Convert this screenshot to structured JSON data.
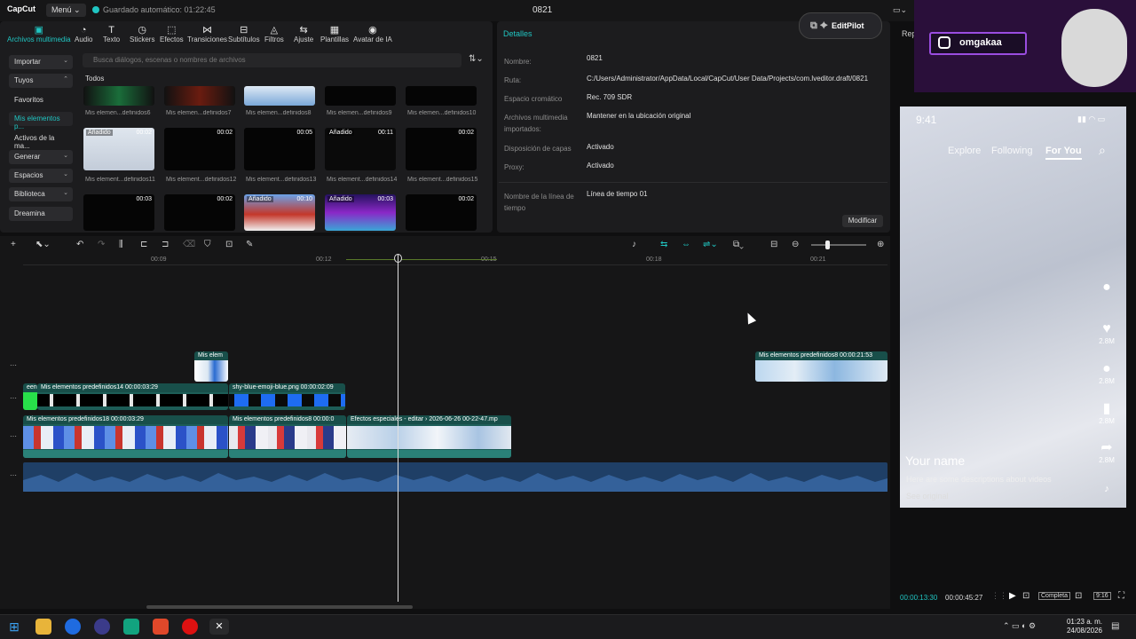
{
  "app": {
    "logo": "CapCut",
    "menu_label": "Menú",
    "autosave": "Guardado automático: 01:22:45",
    "project_name": "0821"
  },
  "toolbar": {
    "items": [
      {
        "label": "Archivos multimedia",
        "icon": "media-icon"
      },
      {
        "label": "Audio",
        "icon": "audio-icon"
      },
      {
        "label": "Texto",
        "icon": "text-icon"
      },
      {
        "label": "Stickers",
        "icon": "stickers-icon"
      },
      {
        "label": "Efectos",
        "icon": "effects-icon"
      },
      {
        "label": "Transiciones",
        "icon": "transitions-icon"
      },
      {
        "label": "Subtítulos",
        "icon": "subtitles-icon"
      },
      {
        "label": "Filtros",
        "icon": "filters-icon"
      },
      {
        "label": "Ajuste",
        "icon": "adjust-icon"
      },
      {
        "label": "Plantillas",
        "icon": "templates-icon"
      },
      {
        "label": "Avatar de IA",
        "icon": "avatar-icon"
      }
    ]
  },
  "sidebar": {
    "items": [
      {
        "label": "Importar"
      },
      {
        "label": "Tuyos"
      },
      {
        "label": "Favoritos"
      },
      {
        "label": "Mis elementos p..."
      },
      {
        "label": "Activos de la ma..."
      },
      {
        "label": "Generar"
      },
      {
        "label": "Espacios"
      },
      {
        "label": "Biblioteca"
      },
      {
        "label": "Dreamina"
      }
    ]
  },
  "media": {
    "search_placeholder": "Busca diálogos, escenas o nombres de archivos",
    "section": "Todos",
    "row1_labels": [
      "Mis elemen...definidos6",
      "Mis elemen...definidos7",
      "Mis elemen...definidos8",
      "Mis elemen...definidos9",
      "Mis elemen...definidos10"
    ],
    "row2": [
      {
        "badge": "Añadido",
        "dur": "00:02",
        "label": "Mis element...definidos11"
      },
      {
        "badge": "",
        "dur": "00:02",
        "label": "Mis element...definidos12"
      },
      {
        "badge": "",
        "dur": "00:05",
        "label": "Mis element...definidos13"
      },
      {
        "badge": "Añadido",
        "dur": "00:11",
        "label": "Mis element...definidos14"
      },
      {
        "badge": "",
        "dur": "00:02",
        "label": "Mis element...definidos15"
      }
    ],
    "row3": [
      {
        "badge": "",
        "dur": "00:03"
      },
      {
        "badge": "",
        "dur": "00:02"
      },
      {
        "badge": "Añadido",
        "dur": "00:10"
      },
      {
        "badge": "Añadido",
        "dur": "00:03"
      },
      {
        "badge": "",
        "dur": "00:02"
      }
    ]
  },
  "details": {
    "title": "Detalles",
    "rows": [
      {
        "key": "Nombre:",
        "value": "0821"
      },
      {
        "key": "Ruta:",
        "value": "C:/Users/Administrator/AppData/Local/CapCut/User Data/Projects/com.lveditor.draft/0821"
      },
      {
        "key": "Espacio cromático",
        "value": "Rec. 709 SDR"
      },
      {
        "key": "Archivos multimedia importados:",
        "value": "Mantener en la ubicación original"
      },
      {
        "key": "Disposición de capas",
        "value": "Activado"
      },
      {
        "key": "Proxy:",
        "value": "Activado"
      },
      {
        "key": "Nombre de la línea de tiempo",
        "value": "Línea de tiempo 01"
      }
    ],
    "modify_label": "Modificar",
    "editpilot_label": "EditPilot"
  },
  "timeline": {
    "ticks": [
      "00:09",
      "00:12",
      "00:15",
      "00:18",
      "00:21"
    ],
    "clips": [
      {
        "label": "Mis elem"
      },
      {
        "label": "Mis elementos predefinidos8  00:00:21:53"
      },
      {
        "label": "een"
      },
      {
        "label": "Mis elementos predefinidos14  00:00:03:29"
      },
      {
        "label": "shy-blue-emoji-blue.png  00:00:02:09"
      },
      {
        "label": "Mis elementos predefinidos18  00:00:03:29"
      },
      {
        "label": "Mis elementos predefinidos8  00:00:0"
      },
      {
        "label": "Efectos especiales - editar ›  2026-06-26 00-22-47.mp"
      }
    ]
  },
  "preview": {
    "rep_label": "Rep",
    "ig_handle": "omgakaa",
    "time": "9:41",
    "tabs": [
      "Explore",
      "Following",
      "For You"
    ],
    "likes": [
      "2.8M",
      "2.8M",
      "2.8M",
      "2.8M"
    ],
    "your_name": "Your name",
    "description": "Here are some descriptions about videos",
    "see_original": "See original",
    "current_time": "00:00:13:30",
    "total_time": "00:00:45:27",
    "complete_label": "Completa",
    "ratio": "9:16"
  },
  "taskbar": {
    "time": "01:23 a. m.",
    "date": "24/08/2026"
  },
  "colors": {
    "accent": "#20c5c2",
    "clip": "#1d5d57",
    "audio": "#1f3f66"
  }
}
